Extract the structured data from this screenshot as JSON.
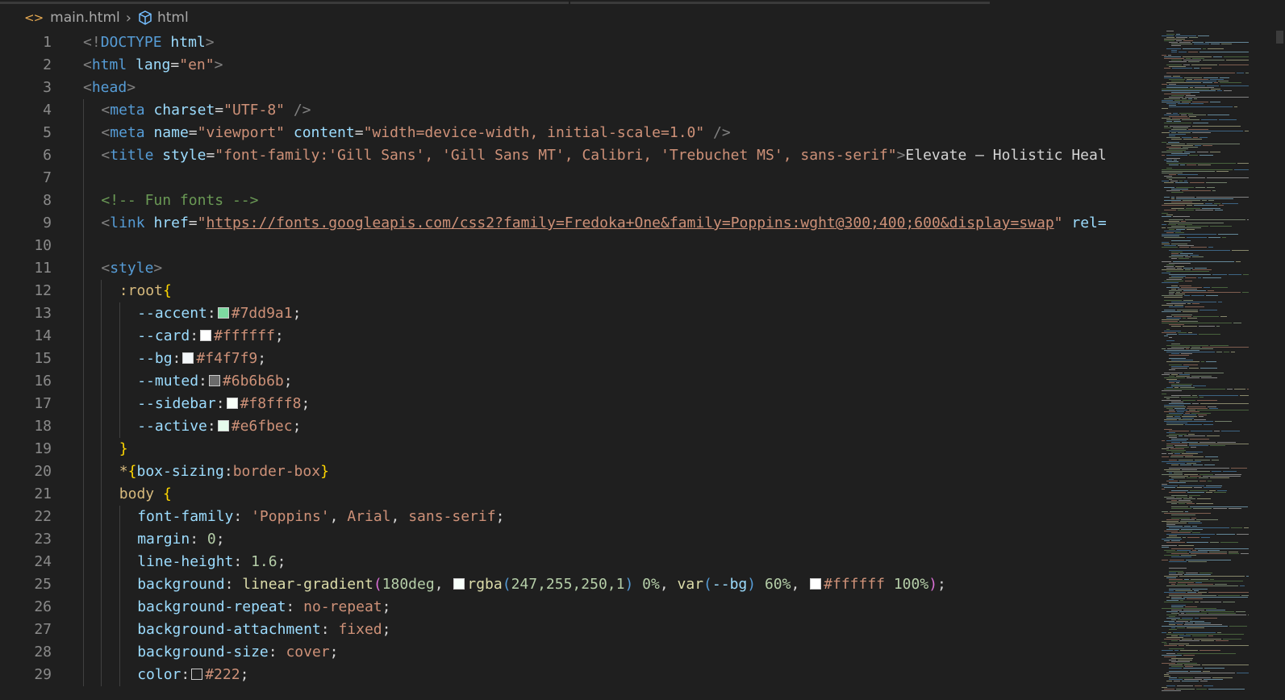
{
  "breadcrumb": {
    "file": "main.html",
    "symbol": "html"
  },
  "colors": {
    "accent": "#7dd9a1",
    "card": "#ffffff",
    "bg": "#f4f7f9",
    "muted": "#6b6b6b",
    "sidebar": "#f8fff8",
    "active": "#e6fbec",
    "gradient_start": "#f7fffa",
    "text": "#222222"
  },
  "lines": [
    {
      "n": "1",
      "indent": 0,
      "tokens": [
        [
          "tag",
          "<!"
        ],
        [
          "name",
          "DOCTYPE"
        ],
        [
          "text",
          " "
        ],
        [
          "attr",
          "html"
        ],
        [
          "tag",
          ">"
        ]
      ]
    },
    {
      "n": "2",
      "indent": 0,
      "tokens": [
        [
          "tag",
          "<"
        ],
        [
          "name",
          "html"
        ],
        [
          "text",
          " "
        ],
        [
          "attr",
          "lang"
        ],
        [
          "text",
          "="
        ],
        [
          "str",
          "\"en\""
        ],
        [
          "tag",
          ">"
        ]
      ]
    },
    {
      "n": "3",
      "indent": 0,
      "tokens": [
        [
          "tag",
          "<"
        ],
        [
          "name",
          "head"
        ],
        [
          "tag",
          ">"
        ]
      ]
    },
    {
      "n": "4",
      "indent": 1,
      "tokens": [
        [
          "tag",
          "<"
        ],
        [
          "name",
          "meta"
        ],
        [
          "text",
          " "
        ],
        [
          "attr",
          "charset"
        ],
        [
          "text",
          "="
        ],
        [
          "str",
          "\"UTF-8\""
        ],
        [
          "text",
          " "
        ],
        [
          "tag",
          "/>"
        ]
      ]
    },
    {
      "n": "5",
      "indent": 1,
      "tokens": [
        [
          "tag",
          "<"
        ],
        [
          "name",
          "meta"
        ],
        [
          "text",
          " "
        ],
        [
          "attr",
          "name"
        ],
        [
          "text",
          "="
        ],
        [
          "str",
          "\"viewport\""
        ],
        [
          "text",
          " "
        ],
        [
          "attr",
          "content"
        ],
        [
          "text",
          "="
        ],
        [
          "str",
          "\"width=device-width, initial-scale=1.0\""
        ],
        [
          "text",
          " "
        ],
        [
          "tag",
          "/>"
        ]
      ]
    },
    {
      "n": "6",
      "indent": 1,
      "tokens": [
        [
          "tag",
          "<"
        ],
        [
          "name",
          "title"
        ],
        [
          "text",
          " "
        ],
        [
          "attr",
          "style"
        ],
        [
          "text",
          "="
        ],
        [
          "str",
          "\"font-family:'Gill Sans', 'Gill Sans MT', Calibri, 'Trebuchet MS', sans-serif\""
        ],
        [
          "tag",
          ">"
        ],
        [
          "text",
          "Elevate — Holistic Heal"
        ]
      ]
    },
    {
      "n": "7",
      "indent": 1,
      "tokens": []
    },
    {
      "n": "8",
      "indent": 1,
      "tokens": [
        [
          "comment",
          "<!-- Fun fonts -->"
        ]
      ]
    },
    {
      "n": "9",
      "indent": 1,
      "tokens": [
        [
          "tag",
          "<"
        ],
        [
          "name",
          "link"
        ],
        [
          "text",
          " "
        ],
        [
          "attr",
          "href"
        ],
        [
          "text",
          "="
        ],
        [
          "str",
          "\""
        ],
        [
          "link",
          "https://fonts.googleapis.com/css2?family=Fredoka+One&family=Poppins:wght@300;400;600&display=swap"
        ],
        [
          "str",
          "\""
        ],
        [
          "text",
          " "
        ],
        [
          "attr",
          "rel="
        ]
      ]
    },
    {
      "n": "10",
      "indent": 1,
      "tokens": []
    },
    {
      "n": "11",
      "indent": 1,
      "tokens": [
        [
          "tag",
          "<"
        ],
        [
          "name",
          "style"
        ],
        [
          "tag",
          ">"
        ]
      ]
    },
    {
      "n": "12",
      "indent": 2,
      "tokens": [
        [
          "sel",
          ":root"
        ],
        [
          "brace",
          "{"
        ]
      ]
    },
    {
      "n": "13",
      "indent": 3,
      "tokens": [
        [
          "attr",
          "--accent"
        ],
        [
          "text",
          ":"
        ],
        [
          "swatch",
          "accent"
        ],
        [
          "str",
          "#7dd9a1"
        ],
        [
          "text",
          ";"
        ]
      ]
    },
    {
      "n": "14",
      "indent": 3,
      "tokens": [
        [
          "attr",
          "--card"
        ],
        [
          "text",
          ":"
        ],
        [
          "swatch",
          "card"
        ],
        [
          "str",
          "#ffffff"
        ],
        [
          "text",
          ";"
        ]
      ]
    },
    {
      "n": "15",
      "indent": 3,
      "tokens": [
        [
          "attr",
          "--bg"
        ],
        [
          "text",
          ":"
        ],
        [
          "swatch",
          "bg"
        ],
        [
          "str",
          "#f4f7f9"
        ],
        [
          "text",
          ";"
        ]
      ]
    },
    {
      "n": "16",
      "indent": 3,
      "tokens": [
        [
          "attr",
          "--muted"
        ],
        [
          "text",
          ":"
        ],
        [
          "swatch",
          "muted"
        ],
        [
          "str",
          "#6b6b6b"
        ],
        [
          "text",
          ";"
        ]
      ]
    },
    {
      "n": "17",
      "indent": 3,
      "tokens": [
        [
          "attr",
          "--sidebar"
        ],
        [
          "text",
          ":"
        ],
        [
          "swatch",
          "sidebar"
        ],
        [
          "str",
          "#f8fff8"
        ],
        [
          "text",
          ";"
        ]
      ]
    },
    {
      "n": "18",
      "indent": 3,
      "tokens": [
        [
          "attr",
          "--active"
        ],
        [
          "text",
          ":"
        ],
        [
          "swatch",
          "active"
        ],
        [
          "str",
          "#e6fbec"
        ],
        [
          "text",
          ";"
        ]
      ]
    },
    {
      "n": "19",
      "indent": 2,
      "tokens": [
        [
          "brace",
          "}"
        ]
      ]
    },
    {
      "n": "20",
      "indent": 2,
      "tokens": [
        [
          "sel",
          "*"
        ],
        [
          "brace",
          "{"
        ],
        [
          "attr",
          "box-sizing"
        ],
        [
          "text",
          ":"
        ],
        [
          "str",
          "border-box"
        ],
        [
          "brace",
          "}"
        ]
      ]
    },
    {
      "n": "21",
      "indent": 2,
      "tokens": [
        [
          "sel",
          "body"
        ],
        [
          "text",
          " "
        ],
        [
          "brace",
          "{"
        ]
      ]
    },
    {
      "n": "22",
      "indent": 3,
      "tokens": [
        [
          "attr",
          "font-family"
        ],
        [
          "text",
          ": "
        ],
        [
          "str",
          "'Poppins'"
        ],
        [
          "text",
          ", "
        ],
        [
          "str",
          "Arial"
        ],
        [
          "text",
          ", "
        ],
        [
          "str",
          "sans-serif"
        ],
        [
          "text",
          ";"
        ]
      ]
    },
    {
      "n": "23",
      "indent": 3,
      "tokens": [
        [
          "attr",
          "margin"
        ],
        [
          "text",
          ": "
        ],
        [
          "num",
          "0"
        ],
        [
          "text",
          ";"
        ]
      ]
    },
    {
      "n": "24",
      "indent": 3,
      "tokens": [
        [
          "attr",
          "line-height"
        ],
        [
          "text",
          ": "
        ],
        [
          "num",
          "1.6"
        ],
        [
          "text",
          ";"
        ]
      ]
    },
    {
      "n": "25",
      "indent": 3,
      "tokens": [
        [
          "attr",
          "background"
        ],
        [
          "text",
          ": "
        ],
        [
          "fn",
          "linear-gradient"
        ],
        [
          "paren",
          "("
        ],
        [
          "num",
          "180deg"
        ],
        [
          "text",
          ", "
        ],
        [
          "swatch",
          "gradient_start"
        ],
        [
          "fn",
          "rgba"
        ],
        [
          "name",
          "("
        ],
        [
          "num",
          "247,255,250,1"
        ],
        [
          "name",
          ")"
        ],
        [
          "text",
          " "
        ],
        [
          "num",
          "0%"
        ],
        [
          "text",
          ", "
        ],
        [
          "fn",
          "var"
        ],
        [
          "name",
          "("
        ],
        [
          "attr",
          "--bg"
        ],
        [
          "name",
          ")"
        ],
        [
          "text",
          " "
        ],
        [
          "num",
          "60%"
        ],
        [
          "text",
          ", "
        ],
        [
          "swatch",
          "card"
        ],
        [
          "str",
          "#ffffff"
        ],
        [
          "text",
          " "
        ],
        [
          "num",
          "100%"
        ],
        [
          "paren",
          ")"
        ],
        [
          "text",
          ";"
        ]
      ]
    },
    {
      "n": "26",
      "indent": 3,
      "tokens": [
        [
          "attr",
          "background-repeat"
        ],
        [
          "text",
          ": "
        ],
        [
          "str",
          "no-repeat"
        ],
        [
          "text",
          ";"
        ]
      ]
    },
    {
      "n": "27",
      "indent": 3,
      "tokens": [
        [
          "attr",
          "background-attachment"
        ],
        [
          "text",
          ": "
        ],
        [
          "str",
          "fixed"
        ],
        [
          "text",
          ";"
        ]
      ]
    },
    {
      "n": "28",
      "indent": 3,
      "tokens": [
        [
          "attr",
          "background-size"
        ],
        [
          "text",
          ": "
        ],
        [
          "str",
          "cover"
        ],
        [
          "text",
          ";"
        ]
      ]
    },
    {
      "n": "29",
      "indent": 3,
      "tokens": [
        [
          "attr",
          "color"
        ],
        [
          "text",
          ":"
        ],
        [
          "swatch",
          "text"
        ],
        [
          "str",
          "#222"
        ],
        [
          "text",
          ";"
        ]
      ]
    }
  ]
}
